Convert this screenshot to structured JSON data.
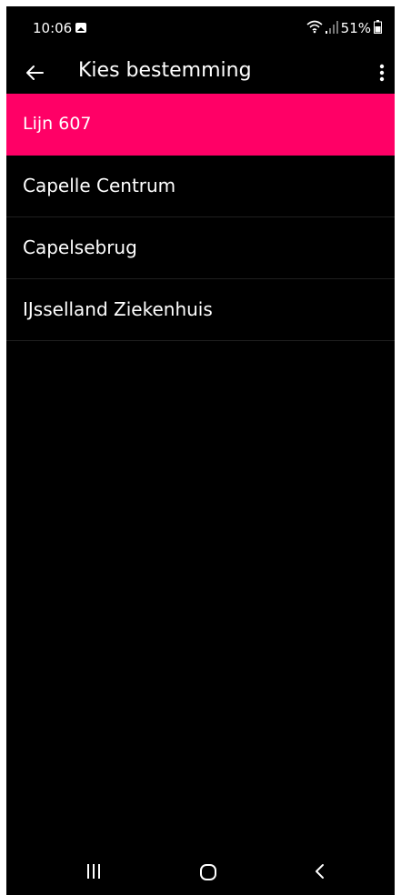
{
  "status_bar": {
    "time": "10:06",
    "battery": "51%",
    "icons": [
      "gallery-icon",
      "wifi-icon",
      "signal-icon",
      "battery-icon"
    ]
  },
  "app_bar": {
    "title": "Kies bestemming",
    "icons": [
      "back-arrow-icon",
      "more-vert-icon"
    ]
  },
  "header": {
    "line_label": "Lijn 607",
    "color": "#ff0066"
  },
  "destinations": [
    {
      "label": "Capelle Centrum"
    },
    {
      "label": "Capelsebrug"
    },
    {
      "label": "IJsselland Ziekenhuis"
    }
  ],
  "nav_bar": {
    "icons": [
      "recents-icon",
      "home-icon",
      "back-icon"
    ]
  },
  "colors": {
    "background": "#000000",
    "accent": "#ff0066",
    "text": "#ffffff"
  }
}
